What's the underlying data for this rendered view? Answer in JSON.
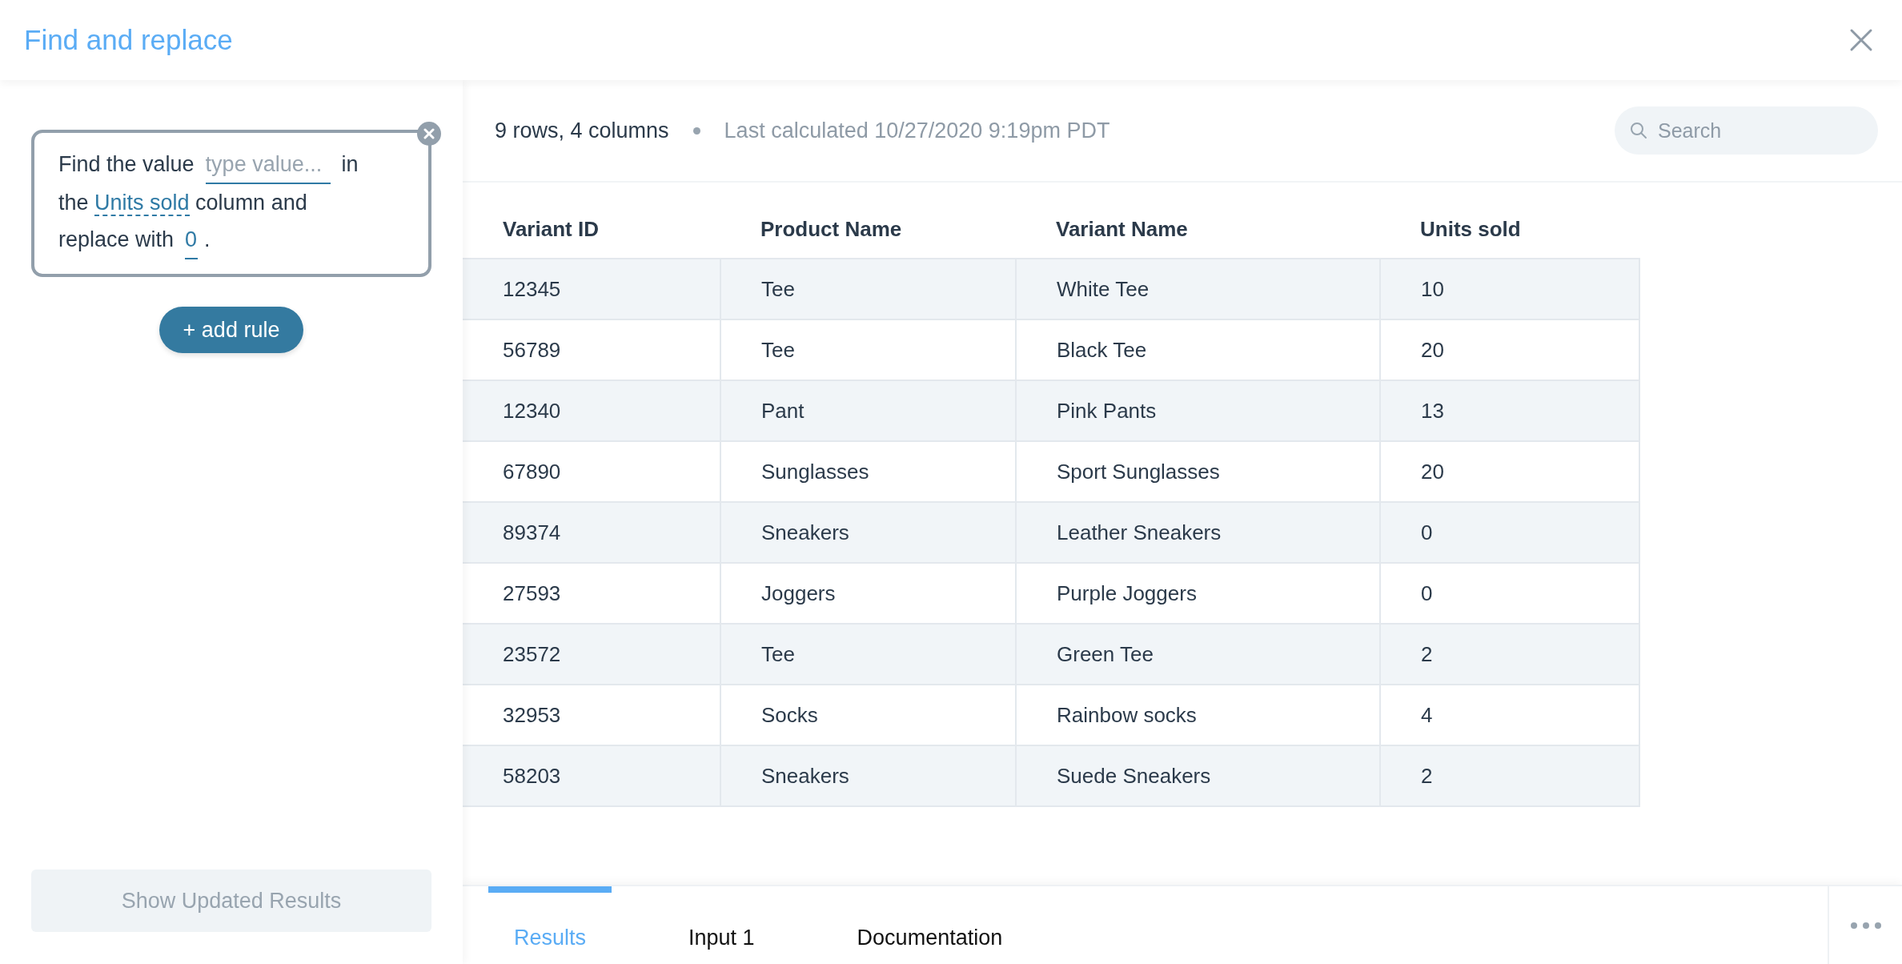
{
  "window": {
    "title": "Find and replace"
  },
  "rule": {
    "text_1": "Find the value",
    "find_field": {
      "placeholder": "type value..."
    },
    "text_2": "in the",
    "column": "Units sold",
    "text_3": "column and replace with",
    "replace_field": {
      "value": "0"
    },
    "text_4": "."
  },
  "add_rule_button": "+ add rule",
  "show_results_button": {
    "label": "Show Updated Results",
    "disabled": true
  },
  "summary": {
    "counts": "9 rows, 4 columns",
    "last_calculated": "Last calculated 10/27/2020 9:19pm PDT"
  },
  "search": {
    "placeholder": "Search"
  },
  "table": {
    "columns": [
      "Variant ID",
      "Product Name",
      "Variant Name",
      "Units sold"
    ],
    "rows": [
      [
        "12345",
        "Tee",
        "White Tee",
        "10"
      ],
      [
        "56789",
        "Tee",
        "Black Tee",
        "20"
      ],
      [
        "12340",
        "Pant",
        "Pink Pants",
        "13"
      ],
      [
        "67890",
        "Sunglasses",
        "Sport Sunglasses",
        "20"
      ],
      [
        "89374",
        "Sneakers",
        "Leather Sneakers",
        "0"
      ],
      [
        "27593",
        "Joggers",
        "Purple Joggers",
        "0"
      ],
      [
        "23572",
        "Tee",
        "Green Tee",
        "2"
      ],
      [
        "32953",
        "Socks",
        "Rainbow socks",
        "4"
      ],
      [
        "58203",
        "Sneakers",
        "Suede Sneakers",
        "2"
      ]
    ]
  },
  "tabs": [
    {
      "label": "Results",
      "selected": true
    },
    {
      "label": "Input 1",
      "selected": false
    },
    {
      "label": "Documentation",
      "selected": false
    }
  ]
}
